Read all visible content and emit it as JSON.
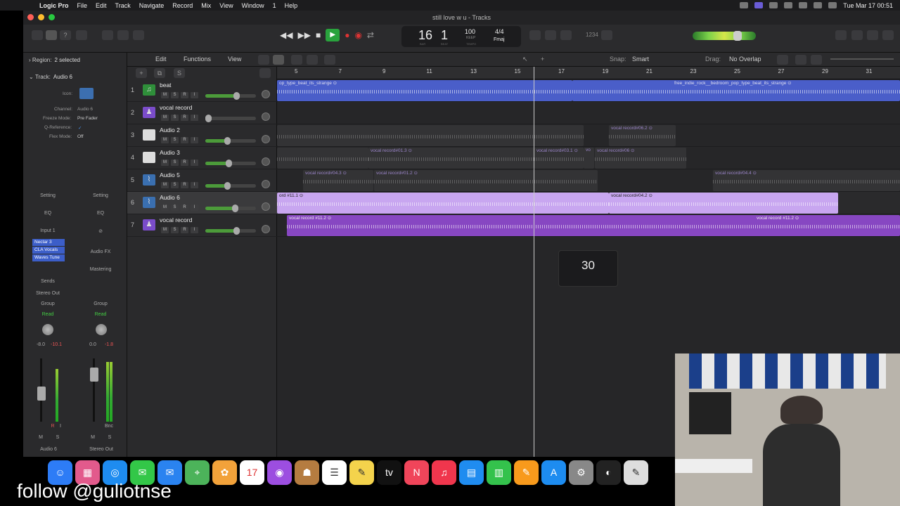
{
  "menubar": {
    "app": "Logic Pro",
    "items": [
      "File",
      "Edit",
      "Track",
      "Navigate",
      "Record",
      "Mix",
      "View",
      "Window",
      "1",
      "Help"
    ],
    "datetime": "Tue Mar 17  00:51"
  },
  "window": {
    "title": "still love w u - Tracks"
  },
  "lcd": {
    "bar": "16",
    "beat": "1",
    "tempo": "100",
    "keep": "KEEP",
    "signature": "4/4",
    "key": "Fmaj",
    "bar_lbl": "BAR",
    "beat_lbl": "BEAT",
    "tempo_lbl": "TEMPO",
    "count_in": "1234"
  },
  "inspector": {
    "region_label": "Region:",
    "region_value": "2 selected",
    "track_label": "Track:",
    "track_value": "Audio 6",
    "props": {
      "icon": "Icon:",
      "channel": "Channel:",
      "channel_val": "Audio 6",
      "freeze": "Freeze Mode:",
      "freeze_val": "Pre Fader",
      "qref": "Q-Reference:",
      "qref_val": "✓",
      "flex": "Flex Mode:",
      "flex_val": "Off"
    },
    "strip1": {
      "setting": "Setting",
      "eq": "EQ",
      "input": "Input 1",
      "plugins": [
        "Nectar 3",
        "CLA Vocals",
        "Waves Tune"
      ],
      "sends": "Sends",
      "output": "Stereo Out",
      "group": "Group",
      "auto": "Read",
      "vol": "-8.0",
      "peak": "-10.1",
      "m": "M",
      "s": "S",
      "i": "I",
      "r": "R",
      "name": "Audio 6"
    },
    "strip2": {
      "setting": "Setting",
      "eq": "EQ",
      "link": "⊘",
      "audiofx": "Audio FX",
      "mastering": "Mastering",
      "group": "Group",
      "auto": "Read",
      "vol": "0.0",
      "peak": "-1.8",
      "bnc": "Bnc",
      "m": "M",
      "s": "S",
      "name": "Stereo Out"
    }
  },
  "tracks_toolbar": {
    "edit": "Edit",
    "functions": "Functions",
    "view": "View",
    "snap_label": "Snap:",
    "snap_value": "Smart",
    "drag_label": "Drag:",
    "drag_value": "No Overlap",
    "solo": "S"
  },
  "ruler": [
    "5",
    "7",
    "9",
    "11",
    "13",
    "15",
    "17",
    "19",
    "21",
    "23",
    "25",
    "27",
    "29",
    "31"
  ],
  "tracks": [
    {
      "num": "1",
      "name": "beat",
      "icon": "♫"
    },
    {
      "num": "2",
      "name": "vocal record",
      "icon": "♟"
    },
    {
      "num": "3",
      "name": "Audio 2",
      "icon": "☺"
    },
    {
      "num": "4",
      "name": "Audio 3",
      "icon": "☺"
    },
    {
      "num": "5",
      "name": "Audio 5",
      "icon": "⌇"
    },
    {
      "num": "6",
      "name": "Audio 6",
      "icon": "⌇"
    },
    {
      "num": "7",
      "name": "vocal record",
      "icon": "♟"
    }
  ],
  "track_buttons": {
    "m": "M",
    "s": "S",
    "r": "R",
    "i": "I"
  },
  "regions": {
    "r1a": "op_type_beat_its_strange ⊙",
    "r1b": "free_indie_rock__bedroom_pop_type_beat_its_strange ⊙",
    "r3a": "vocal record#06.2 ⊙",
    "r4a": "vocal record#01.3 ⊙",
    "r4b": "vocal record#03.1 ⊙",
    "r4c": "vo",
    "r4d": "vocal record#06 ⊙",
    "r5a": "vocal record#04.3 ⊙",
    "r5b": "vocal record#01.2 ⊙",
    "r5c": "vocal record#04.4 ⊙",
    "r6a": "ord #11.1 ⊙",
    "r6b": "vocal record#04.2 ⊙",
    "r7a": "vocal record #11.2 ⊙",
    "r7b": "vocal record #11.2 ⊙"
  },
  "tooltip": {
    "value": "30"
  },
  "caption": "follow @guliotnse",
  "colors": {
    "play": "#29a33d",
    "blue_region": "#4a5ec9",
    "lilac_region": "#c8a6f0",
    "purple_region": "#8747c2"
  }
}
